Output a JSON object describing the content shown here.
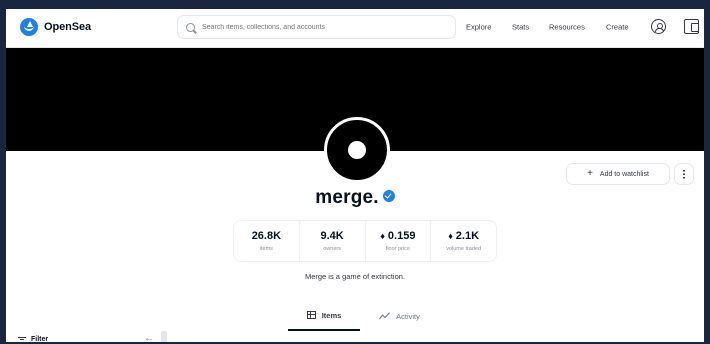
{
  "nav": {
    "logo_text": "OpenSea",
    "search_placeholder": "Search items, collections, and accounts",
    "links": [
      "Explore",
      "Stats",
      "Resources",
      "Create"
    ],
    "icons": [
      "user-icon",
      "wallet-icon"
    ]
  },
  "collection": {
    "title": "merge.",
    "verified": true,
    "watchlist_label": "Add to watchlist",
    "description": "Merge is a game of extinction.",
    "stats": [
      {
        "value": "26.8K",
        "label": "items",
        "eth": false
      },
      {
        "value": "9.4K",
        "label": "owners",
        "eth": false
      },
      {
        "value": "0.159",
        "label": "floor price",
        "eth": true
      },
      {
        "value": "2.1K",
        "label": "volume traded",
        "eth": true
      }
    ]
  },
  "tabs": {
    "items": "Items",
    "activity": "Activity",
    "active": "Items"
  },
  "sidebar": {
    "filter_label": "Filter",
    "collapse_arrow": "←"
  },
  "colors": {
    "accent": "#2081e2",
    "banner": "#000000",
    "text": "#04111d",
    "muted": "#8a939b"
  }
}
